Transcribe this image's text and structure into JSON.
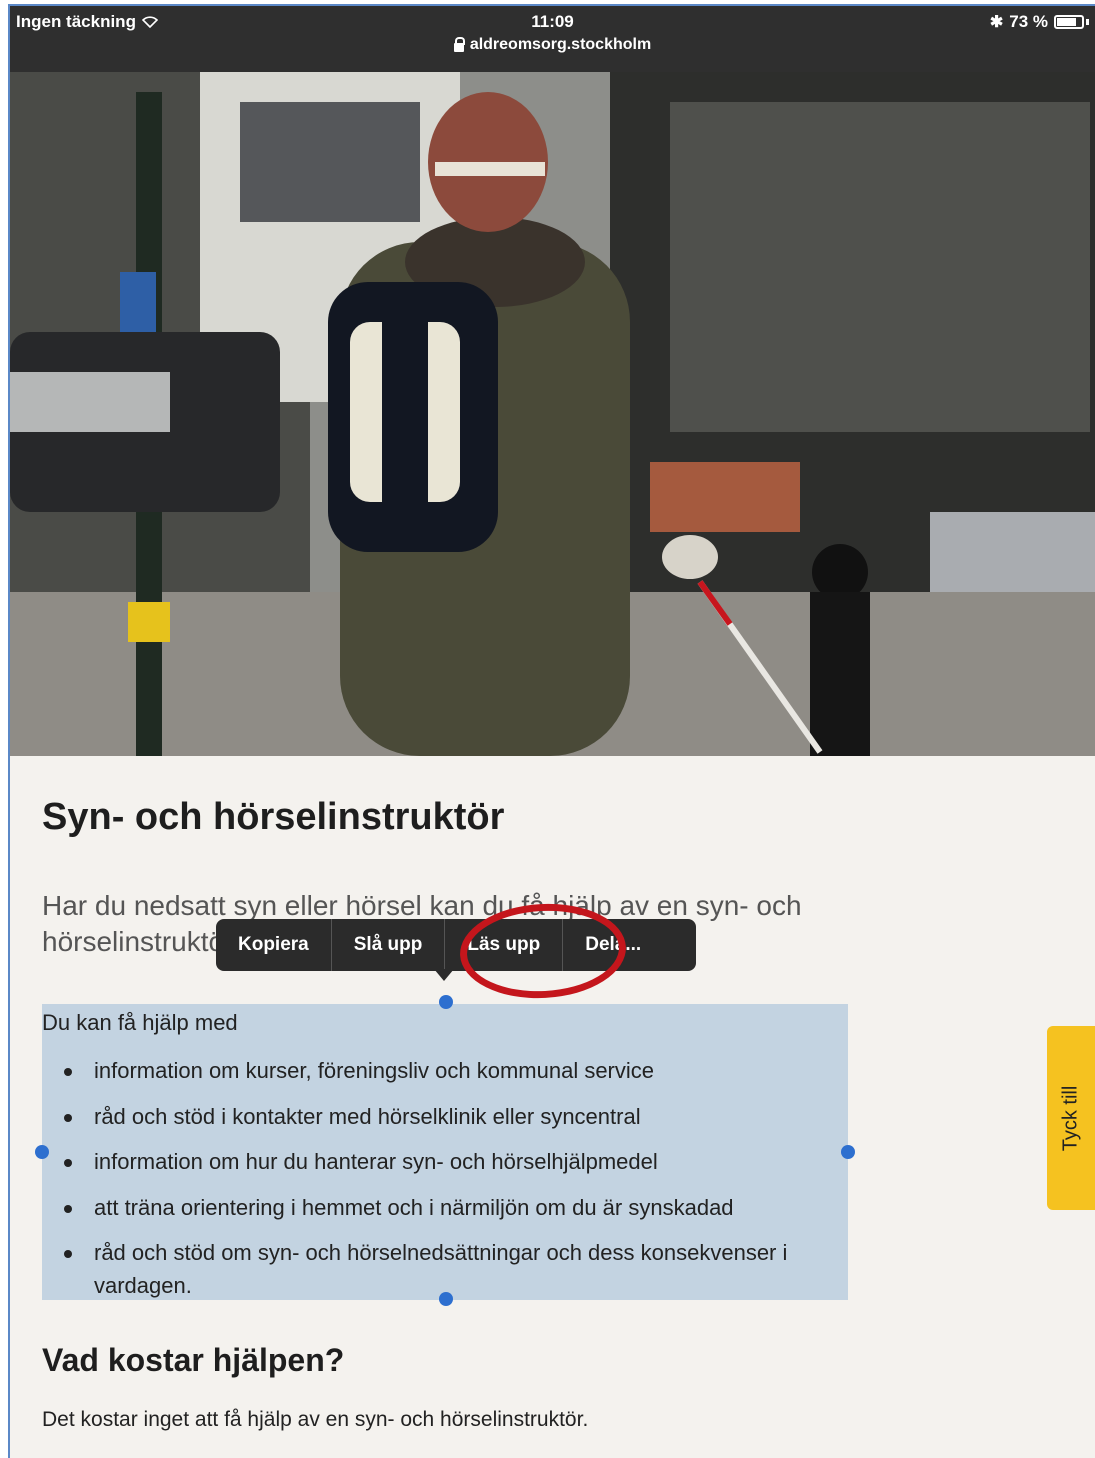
{
  "status_bar": {
    "carrier": "Ingen täckning",
    "time": "11:09",
    "url": "aldreomsorg.stockholm",
    "battery": "73 %"
  },
  "hero": {
    "image_description": "hero-photo"
  },
  "article": {
    "title": "Syn- och hörselinstruktör",
    "lead": "Har du nedsatt syn eller hörsel kan du få hjälp av en syn- och hörselinstruktör.",
    "help_intro": "Du kan få hjälp med",
    "help_items": [
      "information om kurser, föreningsliv och kommunal service",
      "råd och stöd i kontakter med hörselklinik eller syncentral",
      "information om hur du hanterar syn- och hörselhjälpmedel",
      "att träna orientering i hemmet och i närmiljön om du är synskadad",
      "råd och stöd om syn- och hörselnedsättningar och dess konsekvenser i vardagen."
    ],
    "cost_heading": "Vad kostar hjälpen?",
    "cost_text": "Det kostar inget att få hjälp av en syn- och hörselinstruktör."
  },
  "context_menu": {
    "items": [
      "Kopiera",
      "Slå upp",
      "Läs upp",
      "Dela..."
    ]
  },
  "feedback_tab": {
    "label": "Tyck till"
  },
  "colors": {
    "selection": "#c3d3e1",
    "handle": "#2d6fcf",
    "annotation": "#c4161c",
    "feedback": "#f5c220",
    "statusbar": "#2f2f2f"
  }
}
